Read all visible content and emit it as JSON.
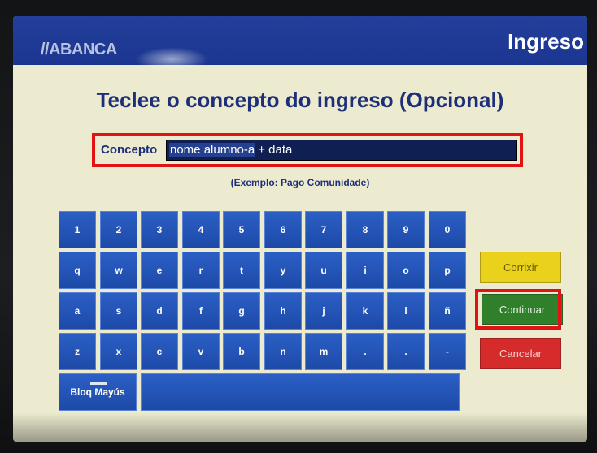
{
  "header": {
    "brand": "//ABANCA",
    "section_title": "Ingreso"
  },
  "title": "Teclee o concepto do ingreso (Opcional)",
  "concept": {
    "label": "Concepto",
    "typed_value": "nome alumno-a",
    "appended_text": "+ data"
  },
  "example": "(Exemplo: Pago Comunidade)",
  "keyboard": {
    "row1": [
      "1",
      "2",
      "3",
      "4",
      "5",
      "6",
      "7",
      "8",
      "9",
      "0"
    ],
    "row2": [
      "q",
      "w",
      "e",
      "r",
      "t",
      "y",
      "u",
      "i",
      "o",
      "p"
    ],
    "row3": [
      "a",
      "s",
      "d",
      "f",
      "g",
      "h",
      "j",
      "k",
      "l",
      "ñ"
    ],
    "row4": [
      "z",
      "x",
      "c",
      "v",
      "b",
      "n",
      "m",
      ".",
      ".",
      "-"
    ],
    "caps_label": "Bloq Mayús"
  },
  "buttons": {
    "corrixir": "Corrixir",
    "continuar": "Continuar",
    "cancelar": "Cancelar"
  },
  "colors": {
    "header_blue": "#1b3690",
    "screen_bg": "#ecebcf",
    "key_blue": "#1d4aa8",
    "highlight_red": "#e01414",
    "yellow": "#e9d11c",
    "green": "#2f7f2b",
    "red": "#d52b2b"
  }
}
